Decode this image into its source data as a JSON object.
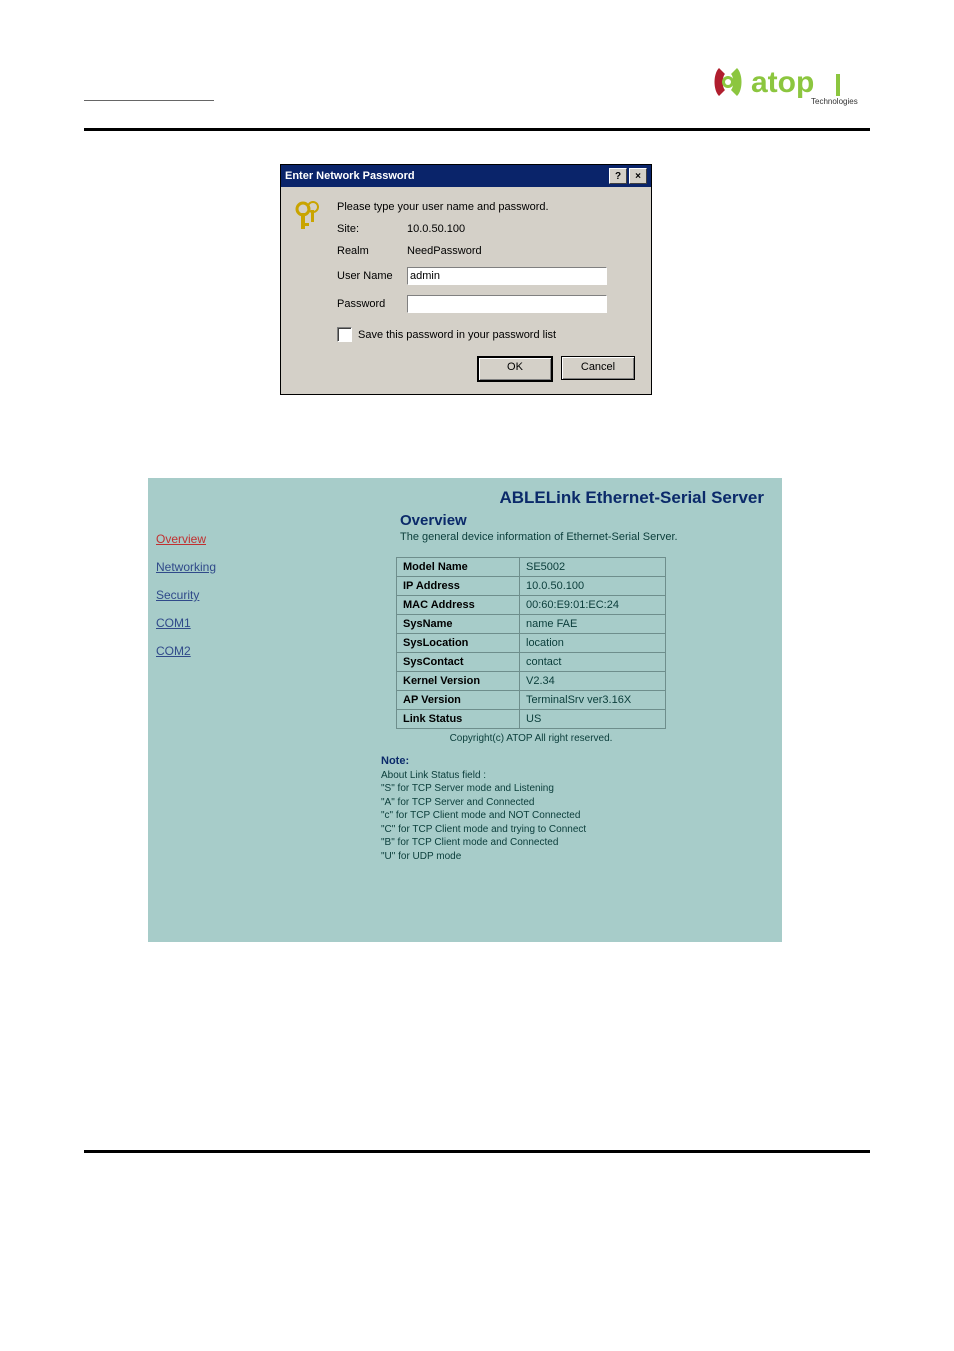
{
  "logo": {
    "main": "atop",
    "sub": "Technologies"
  },
  "dialog": {
    "title": "Enter Network Password",
    "help_glyph": "?",
    "close_glyph": "×",
    "prompt": "Please type your user name and password.",
    "site_label": "Site:",
    "site_value": "10.0.50.100",
    "realm_label": "Realm",
    "realm_value": "NeedPassword",
    "username_label": "User Name",
    "username_value": "admin",
    "password_label": "Password",
    "password_value": "",
    "save_label": "Save this password in your password list",
    "ok": "OK",
    "cancel": "Cancel"
  },
  "sidebar": {
    "items": [
      {
        "label": "Overview",
        "active": true
      },
      {
        "label": "Networking",
        "active": false
      },
      {
        "label": "Security",
        "active": false
      },
      {
        "label": "COM1",
        "active": false
      },
      {
        "label": "COM2",
        "active": false
      }
    ]
  },
  "main": {
    "banner": "ABLELink Ethernet-Serial Server",
    "title": "Overview",
    "subtitle": "The general device information of Ethernet-Serial Server.",
    "rows": [
      {
        "k": "Model Name",
        "v": "SE5002"
      },
      {
        "k": "IP Address",
        "v": "10.0.50.100"
      },
      {
        "k": "MAC Address",
        "v": "00:60:E9:01:EC:24"
      },
      {
        "k": "SysName",
        "v": "name FAE"
      },
      {
        "k": "SysLocation",
        "v": "location"
      },
      {
        "k": "SysContact",
        "v": "contact"
      },
      {
        "k": "Kernel Version",
        "v": "V2.34"
      },
      {
        "k": "AP Version",
        "v": "TerminalSrv ver3.16X"
      },
      {
        "k": "Link Status",
        "v": "US"
      }
    ],
    "copyright": "Copyright(c) ATOP All right reserved.",
    "note_title": "Note:",
    "note_lines": [
      "About Link Status field :",
      "\"S\" for TCP Server mode and Listening",
      "\"A\" for TCP Server and Connected",
      "\"c\" for TCP Client mode and NOT Connected",
      "\"C\" for TCP Client mode and trying to Connect",
      "\"B\" for TCP Client mode and Connected",
      "\"U\" for UDP mode"
    ]
  }
}
